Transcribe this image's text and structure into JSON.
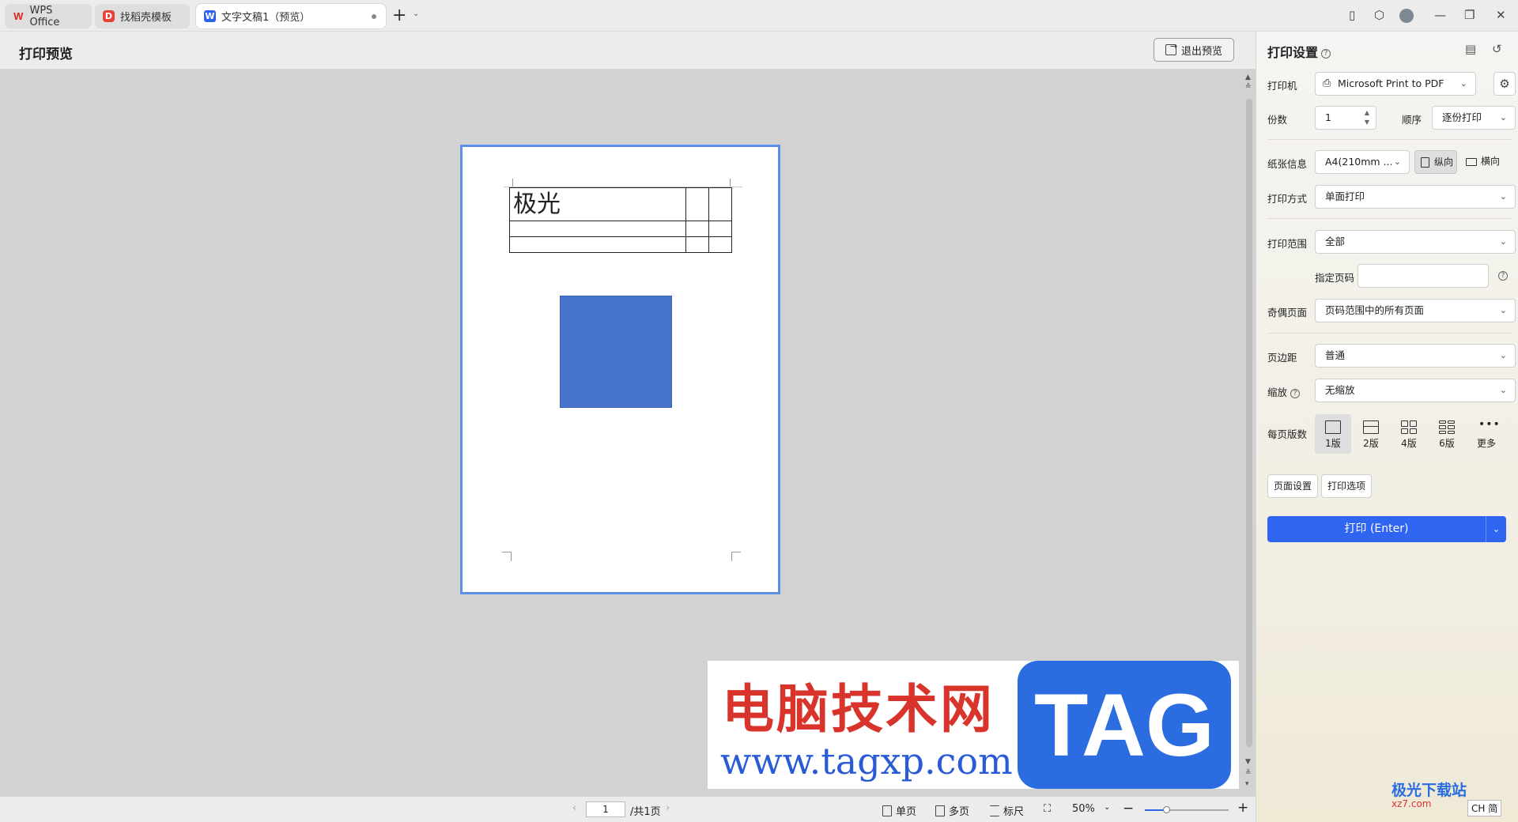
{
  "tabs": [
    {
      "label": "WPS Office",
      "icon": "wps-logo-icon"
    },
    {
      "label": "找稻壳模板",
      "icon": "daoke-icon"
    },
    {
      "label": "文字文稿1（预览）",
      "icon": "word-doc-icon",
      "active": true
    }
  ],
  "header": {
    "title": "打印预览",
    "exit_label": "退出预览"
  },
  "document": {
    "table_first_cell": "极光",
    "table_rows": 3,
    "table_cols": 3,
    "shape_color": "#4774cc"
  },
  "watermark": {
    "cn_text": "电脑技术网",
    "url_text": "www.tagxp.com",
    "tag_text": "TAG"
  },
  "statusbar": {
    "page_value": "1",
    "page_total": "/共1页",
    "single_page": "单页",
    "multi_page": "多页",
    "ruler": "标尺",
    "zoom": "50%",
    "zoom_fraction": 0.25
  },
  "settings": {
    "title": "打印设置",
    "printer_label": "打印机",
    "printer_value": "Microsoft Print to PDF",
    "copies_label": "份数",
    "copies_value": "1",
    "order_label": "顺序",
    "order_value": "逐份打印",
    "paper_label": "纸张信息",
    "paper_value": "A4(210mm ...",
    "portrait": "纵向",
    "landscape": "横向",
    "method_label": "打印方式",
    "method_value": "单面打印",
    "range_label": "打印范围",
    "range_value": "全部",
    "pages_label": "指定页码",
    "pages_value": "",
    "oddeven_label": "奇偶页面",
    "oddeven_value": "页码范围中的所有页面",
    "margin_label": "页边距",
    "margin_value": "普通",
    "scale_label": "缩放",
    "scale_value": "无缩放",
    "perpage_label": "每页版数",
    "perpage_options": [
      "1版",
      "2版",
      "4版",
      "6版",
      "更多"
    ],
    "page_setup": "页面设置",
    "print_options": "打印选项",
    "print_button": "打印 (Enter)"
  },
  "corner": {
    "logo_text": "极光下载站",
    "logo_sub": "xz7.com",
    "ime_text": "CH 简"
  },
  "colors": {
    "accent": "#2f65f0",
    "page_border": "#5b8fe8",
    "watermark_red": "#d9342b",
    "watermark_blue": "#2b6de0"
  }
}
